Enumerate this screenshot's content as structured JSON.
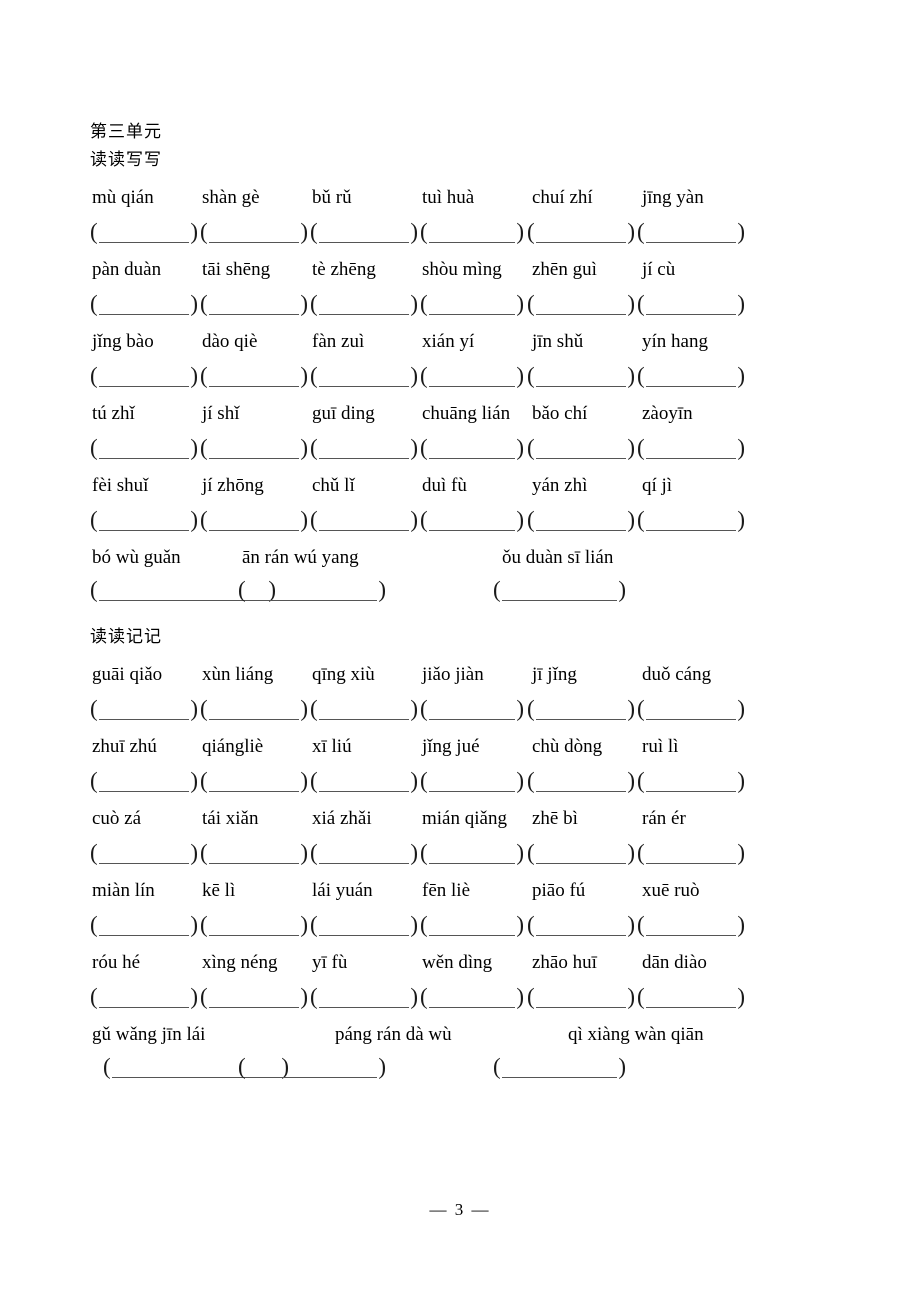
{
  "document": {
    "unit_title": "第三单元",
    "page_number": "— 3 —"
  },
  "sections": [
    {
      "id": "dudu-xiexie",
      "title": "读读写写",
      "rows": [
        {
          "type": "six",
          "items": [
            "mù qián",
            "shàn gè",
            "bǔ rǔ",
            "tuì huà",
            "chuí zhí",
            "jīng yàn"
          ]
        },
        {
          "type": "six",
          "items": [
            "pàn duàn",
            "tāi shēng",
            "tè zhēng",
            "shòu mìng",
            "zhēn guì",
            "jí cù"
          ]
        },
        {
          "type": "six",
          "items": [
            "jǐng bào",
            "dào qiè",
            "fàn zuì",
            "xián yí",
            "jīn shǔ",
            "yín hang"
          ]
        },
        {
          "type": "six",
          "items": [
            "tú zhǐ",
            "jí shǐ",
            "guī ding",
            "chuāng lián",
            "bǎo chí",
            "zàoyīn"
          ]
        },
        {
          "type": "six",
          "items": [
            "fèi shuǐ",
            "jí zhōng",
            "chǔ lǐ",
            "duì fù",
            "yán zhì",
            "qí jì"
          ]
        },
        {
          "type": "three",
          "items": [
            "bó wù guǎn",
            "ān rán wú yang",
            "ǒu duàn sī lián"
          ]
        }
      ]
    },
    {
      "id": "dudu-jiji",
      "title": "读读记记",
      "rows": [
        {
          "type": "six",
          "items": [
            "guāi qiǎo",
            "xùn liáng",
            "qīng xiù",
            "jiǎo jiàn",
            "jī jǐng",
            "duǒ cáng"
          ]
        },
        {
          "type": "six",
          "items": [
            "zhuī zhú",
            "qiángliè",
            "xī liú",
            "jǐng jué",
            "chù dòng",
            "ruì lì"
          ]
        },
        {
          "type": "six",
          "items": [
            "cuò zá",
            "tái xiǎn",
            "xiá zhǎi",
            "mián qiǎng",
            "zhē bì",
            "rán ér"
          ]
        },
        {
          "type": "six",
          "items": [
            "miàn lín",
            "kē lì",
            "lái yuán",
            "fēn liè",
            "piāo fú",
            "xuē ruò"
          ]
        },
        {
          "type": "six",
          "items": [
            "róu hé",
            "xìng néng",
            "yī fù",
            "wěn dìng",
            "zhāo huī",
            "dān diào"
          ]
        },
        {
          "type": "three_last",
          "items": [
            "gǔ wǎng jīn lái",
            "páng rán dà wù",
            "qì xiàng wàn qiān"
          ]
        }
      ]
    }
  ]
}
